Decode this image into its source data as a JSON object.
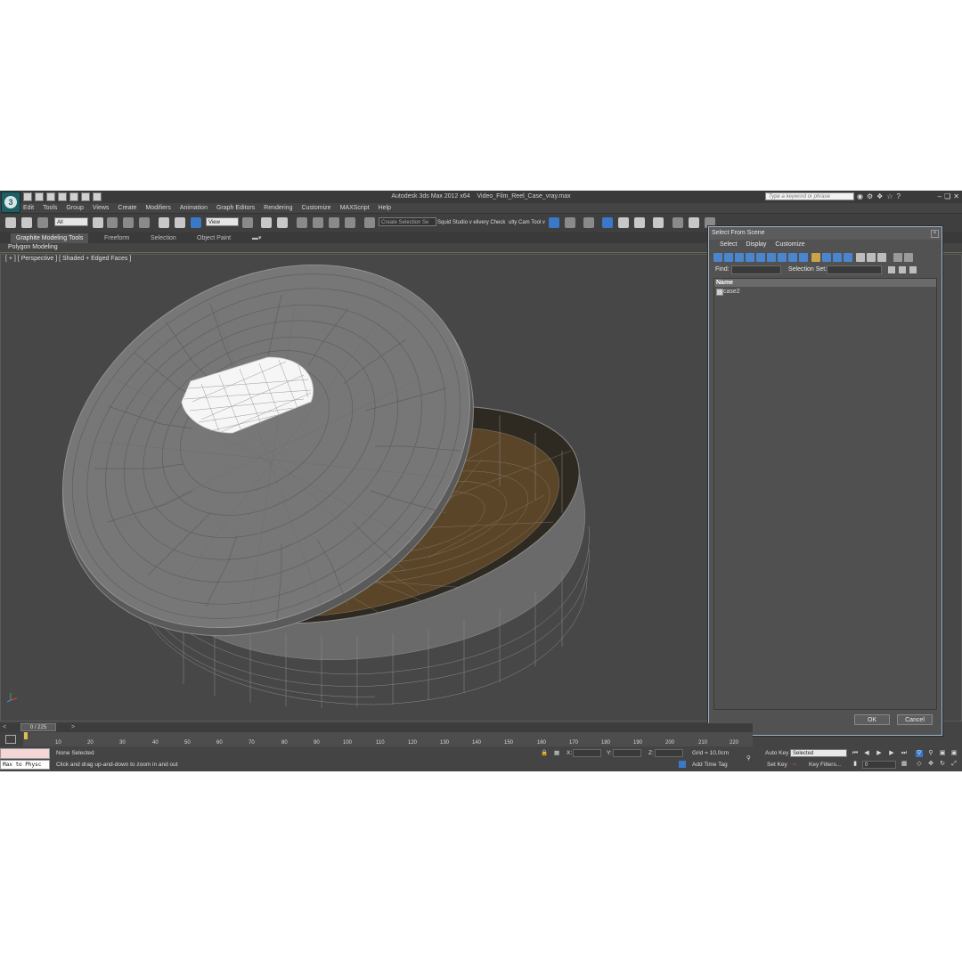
{
  "title_bar": {
    "app_title": "Autodesk 3ds Max  2012 x64",
    "file_name": "Video_Film_Reel_Case_vray.max",
    "search_placeholder": "Type a keyword or phrase"
  },
  "menu": [
    "Edit",
    "Tools",
    "Group",
    "Views",
    "Create",
    "Modifiers",
    "Animation",
    "Graph Editors",
    "Rendering",
    "Customize",
    "MAXScript",
    "Help"
  ],
  "toolbar": {
    "selection_filter": "All",
    "reference_coord": "View",
    "selection_set": "Create Selection Se",
    "squid_label": "Squid Studio v elivery Check",
    "cam_tool_label": "ulty Cam Tool v"
  },
  "ribbon": {
    "tabs": [
      "Graphite Modeling Tools",
      "Freeform",
      "Selection",
      "Object Paint"
    ],
    "panel_label": "Polygon Modeling"
  },
  "viewport": {
    "label": "[ + ] [ Perspective ] [ Shaded + Edged Faces ]"
  },
  "dialog": {
    "title": "Select From Scene",
    "menu": [
      "Select",
      "Display",
      "Customize"
    ],
    "find_label": "Find:",
    "selection_set_label": "Selection Set:",
    "column_name": "Name",
    "items": [
      "case2"
    ],
    "ok_label": "OK",
    "cancel_label": "Cancel"
  },
  "time_slider": {
    "frame_display": "0 / 225",
    "ticks": [
      "10",
      "20",
      "30",
      "40",
      "50",
      "60",
      "70",
      "80",
      "90",
      "100",
      "110",
      "120",
      "130",
      "140",
      "150",
      "160",
      "170",
      "180",
      "190",
      "200",
      "210",
      "220"
    ]
  },
  "status_bar": {
    "maxscript_text": "Max to Physc",
    "selection_status": "None Selected",
    "prompt": "Click and drag up-and-down to zoom in and out",
    "x_label": "X:",
    "y_label": "Y:",
    "z_label": "Z:",
    "grid": "Grid = 10,0cm",
    "add_time_tag": "Add Time Tag",
    "auto_key": "Auto Key",
    "set_key": "Set Key",
    "key_mode": "Selected",
    "key_filters": "Key Filters...",
    "current_frame": "0"
  },
  "colors": {
    "ui_bg": "#444444",
    "viewport_bg": "#474747",
    "dialog_border": "#9bb4d0",
    "accent_blue": "#3a78c8"
  }
}
